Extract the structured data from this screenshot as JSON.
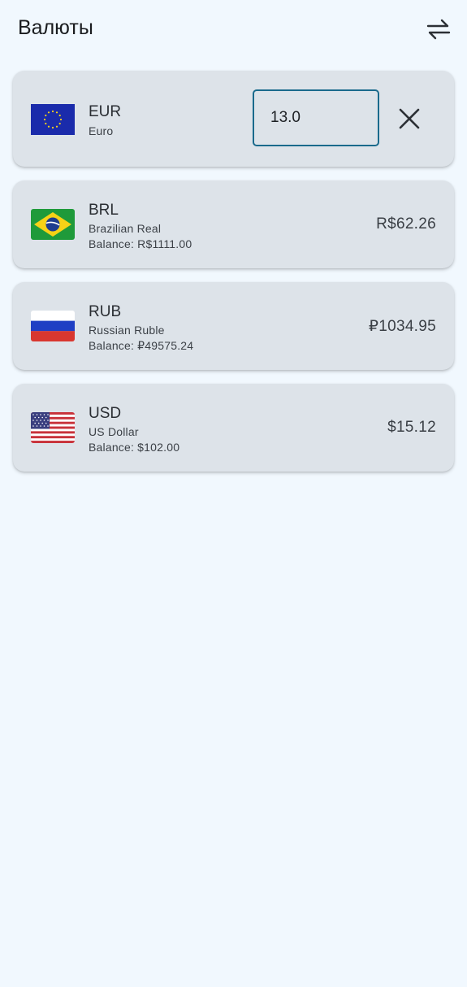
{
  "app_bar": {
    "title": "Валюты",
    "swap_icon": "swap-horiz-icon"
  },
  "base_currency": {
    "code": "EUR",
    "name": "Euro",
    "flag_icon": "eu-flag-icon",
    "amount_input_value": "13.0",
    "clear_icon": "close-icon"
  },
  "currencies": [
    {
      "code": "BRL",
      "name": "Brazilian Real",
      "balance": "Balance: R$1111.00",
      "amount": "R$62.26",
      "flag_icon": "brazil-flag-icon"
    },
    {
      "code": "RUB",
      "name": "Russian Ruble",
      "balance": "Balance: ₽49575.24",
      "amount": "₽1034.95",
      "flag_icon": "russia-flag-icon"
    },
    {
      "code": "USD",
      "name": "US Dollar",
      "balance": "Balance: $102.00",
      "amount": "$15.12",
      "flag_icon": "usa-flag-icon"
    }
  ],
  "colors": {
    "background": "#f1f8fe",
    "card": "#dde3e9",
    "input_border": "#1a6a8c"
  }
}
